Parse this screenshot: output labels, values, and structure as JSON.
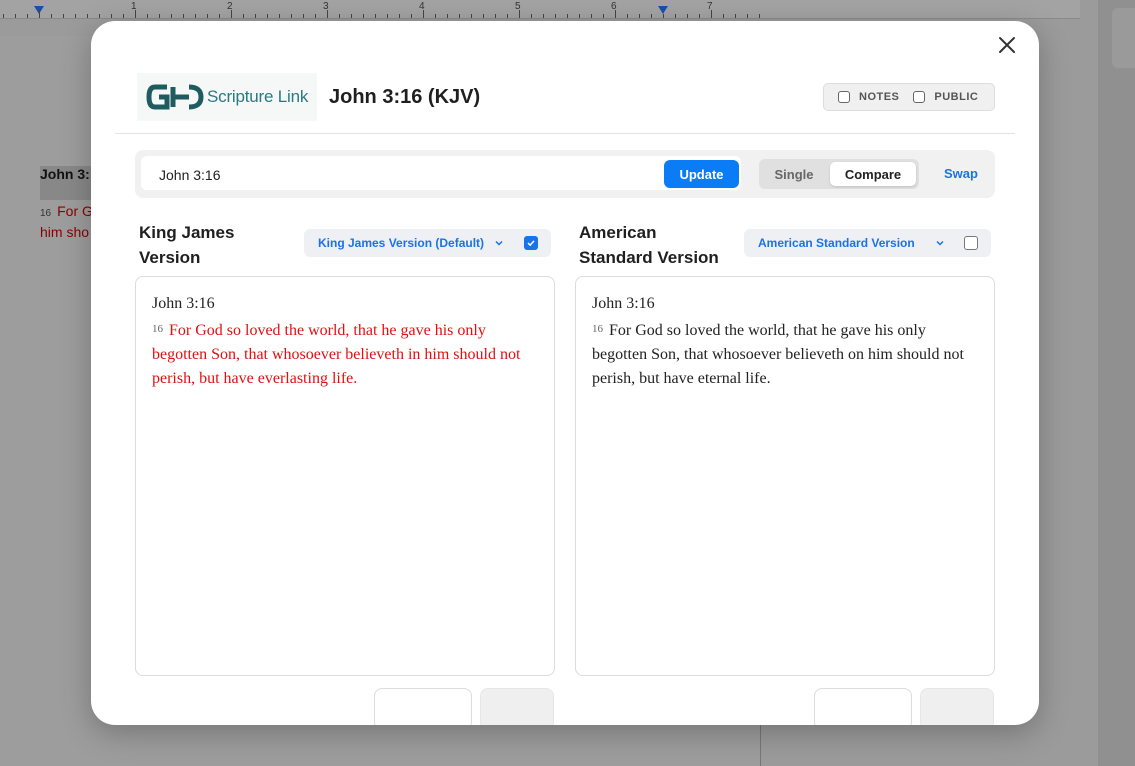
{
  "background": {
    "ruler_numbers": [
      "1",
      "2",
      "3",
      "4",
      "5",
      "6",
      "7"
    ],
    "doc_heading": "John 3:",
    "doc_verse_number": "16",
    "doc_verse_line1": "For G",
    "doc_verse_line2": "him sho"
  },
  "modal": {
    "logo_text": "Scripture Link",
    "title": "John 3:16 (KJV)",
    "toggles": {
      "notes_label": "NOTES",
      "public_label": "PUBLIC"
    },
    "search": {
      "value": "John 3:16"
    },
    "update_label": "Update",
    "view_mode": {
      "single_label": "Single",
      "compare_label": "Compare",
      "selected": "Compare"
    },
    "swap_label": "Swap",
    "columns": [
      {
        "title": "King James Version",
        "version_select": "King James Version (Default)",
        "checked": true,
        "reference": "John 3:16",
        "verse_number": "16",
        "verse_text": "For God so loved the world, that he gave his only begotten Son, that whosoever believeth in him should not perish, but have everlasting life.",
        "text_color": "#e01010"
      },
      {
        "title": "American Standard Version",
        "version_select": "American Standard Version",
        "checked": false,
        "reference": "John 3:16",
        "verse_number": "16",
        "verse_text": "For God so loved the world, that he gave his only begotten Son, that whosoever believeth on him should not perish, but have eternal life.",
        "text_color": "#222222"
      }
    ]
  },
  "colors": {
    "accent": "#0a7cf5",
    "link": "#1a73e8",
    "brand": "#2a7a7f"
  },
  "icons": [
    "close-icon",
    "chevron-down-icon",
    "checkbox-icon",
    "logo-mark"
  ]
}
